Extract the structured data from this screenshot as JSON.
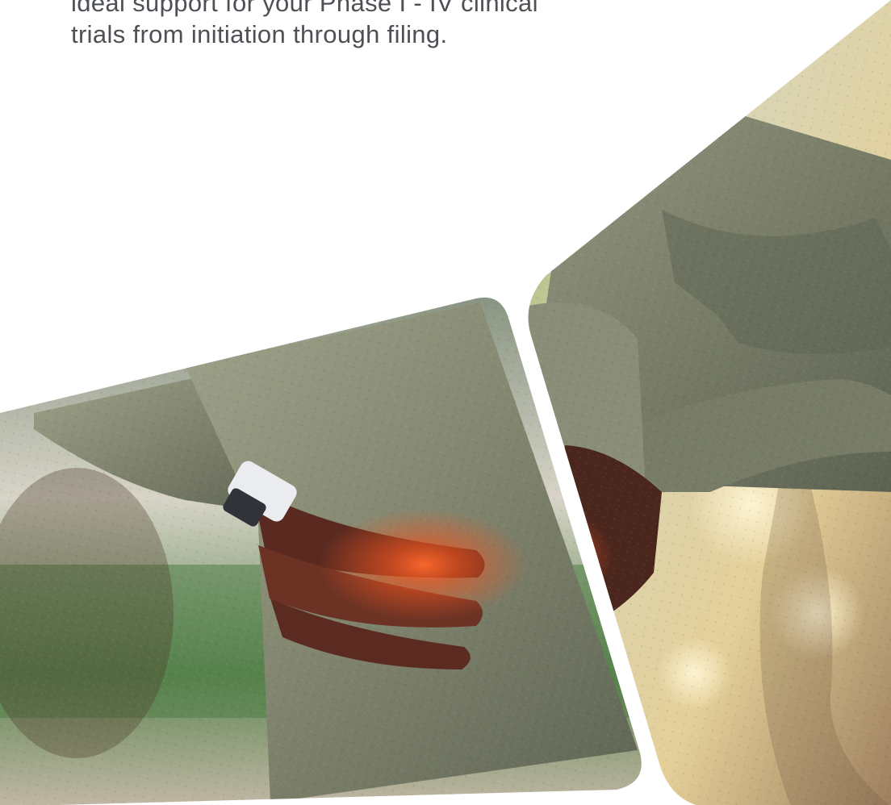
{
  "intro": {
    "lines": [
      "ideal support for your Phase I - IV clinical",
      "trials from initiation through filing."
    ]
  },
  "imagery": {
    "left_panel": "back-pain-photo-left",
    "right_panel": "back-pain-photo-right"
  },
  "colors": {
    "text": "#4d5156",
    "sweater_light": "#8d9077",
    "sweater_dark": "#616652",
    "sunlight": "#e3cf9b",
    "pain_glow": "#ff5a24"
  }
}
